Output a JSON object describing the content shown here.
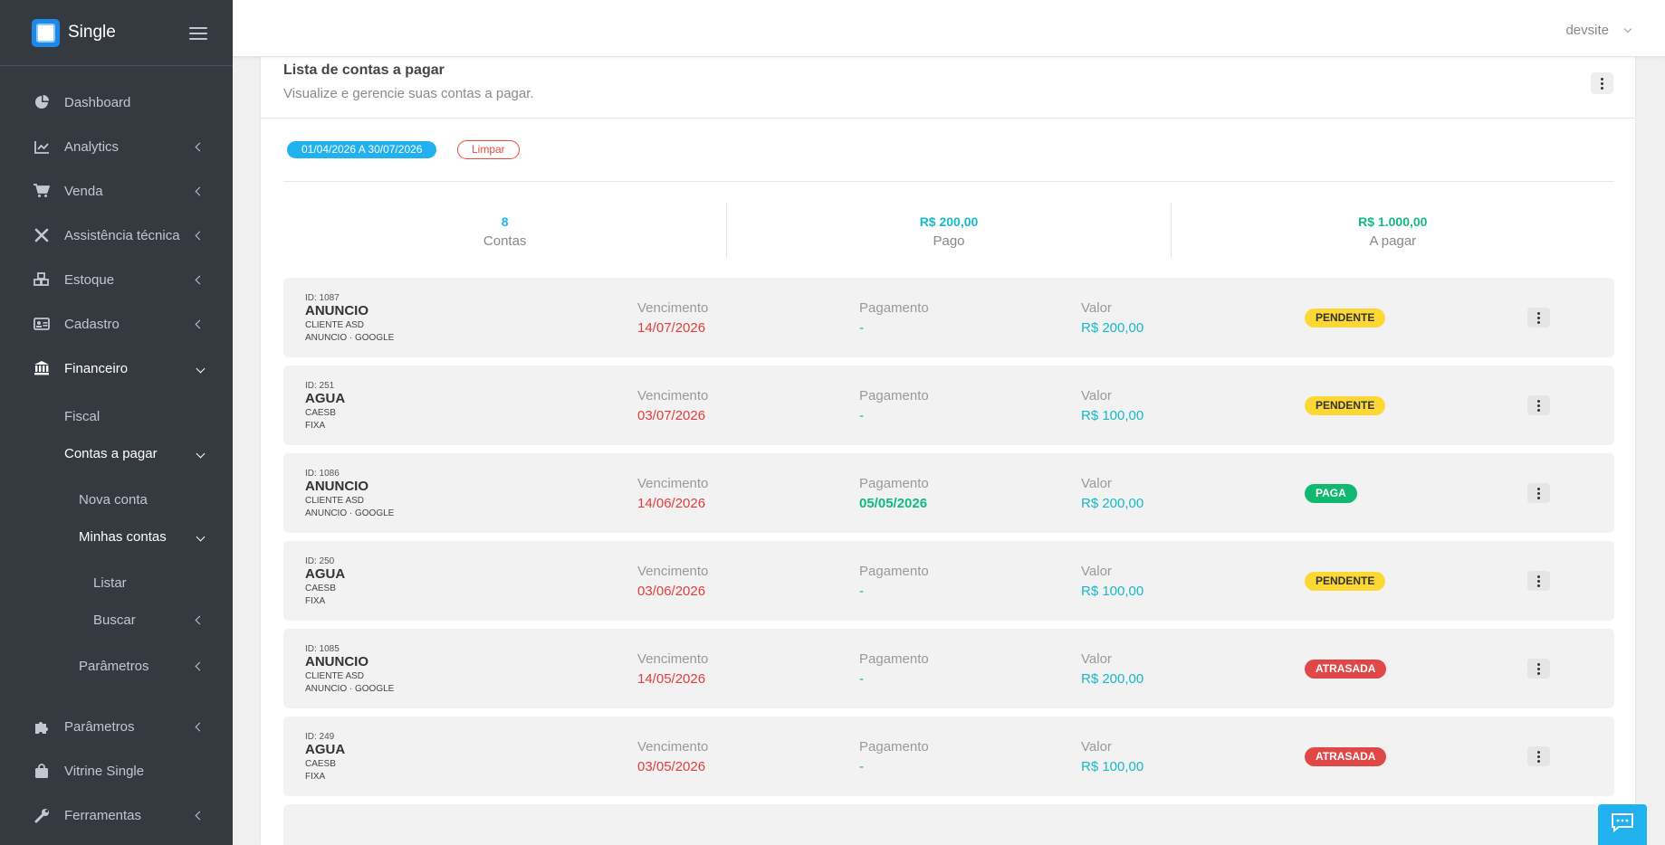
{
  "app": {
    "name": "Single"
  },
  "user": {
    "name": "devsite"
  },
  "sidebar": {
    "items": [
      {
        "label": "Dashboard"
      },
      {
        "label": "Analytics"
      },
      {
        "label": "Venda"
      },
      {
        "label": "Assistência técnica"
      },
      {
        "label": "Estoque"
      },
      {
        "label": "Cadastro"
      },
      {
        "label": "Financeiro"
      },
      {
        "label": "Fiscal"
      },
      {
        "label": "Contas a pagar"
      },
      {
        "label": "Nova conta"
      },
      {
        "label": "Minhas contas"
      },
      {
        "label": "Listar"
      },
      {
        "label": "Buscar"
      },
      {
        "label": "Parâmetros"
      },
      {
        "label": "Parâmetros"
      },
      {
        "label": "Vitrine Single"
      },
      {
        "label": "Ferramentas"
      }
    ]
  },
  "page": {
    "title": "Lista de contas a pagar",
    "subtitle": "Visualize e gerencie suas contas a pagar."
  },
  "filter": {
    "date_range": "01/04/2026 A 30/07/2026",
    "clear_label": "Limpar"
  },
  "stats": [
    {
      "value": "8",
      "label": "Contas"
    },
    {
      "value": "R$ 200,00",
      "label": "Pago"
    },
    {
      "value": "R$ 1.000,00",
      "label": "A pagar"
    }
  ],
  "columns": {
    "vencimento": "Vencimento",
    "pagamento": "Pagamento",
    "valor": "Valor"
  },
  "rows": [
    {
      "id": "ID: 1087",
      "name": "ANUNCIO",
      "line1": "CLIENTE ASD",
      "line2": "ANUNCIO · GOOGLE",
      "vencimento": "14/07/2026",
      "pagamento": "-",
      "valor": "R$ 200,00",
      "status": "PENDENTE"
    },
    {
      "id": "ID: 251",
      "name": "AGUA",
      "line1": "CAESB",
      "line2": "FIXA",
      "vencimento": "03/07/2026",
      "pagamento": "-",
      "valor": "R$ 100,00",
      "status": "PENDENTE"
    },
    {
      "id": "ID: 1086",
      "name": "ANUNCIO",
      "line1": "CLIENTE ASD",
      "line2": "ANUNCIO · GOOGLE",
      "vencimento": "14/06/2026",
      "pagamento": "05/05/2026",
      "valor": "R$ 200,00",
      "status": "PAGA"
    },
    {
      "id": "ID: 250",
      "name": "AGUA",
      "line1": "CAESB",
      "line2": "FIXA",
      "vencimento": "03/06/2026",
      "pagamento": "-",
      "valor": "R$ 100,00",
      "status": "PENDENTE"
    },
    {
      "id": "ID: 1085",
      "name": "ANUNCIO",
      "line1": "CLIENTE ASD",
      "line2": "ANUNCIO · GOOGLE",
      "vencimento": "14/05/2026",
      "pagamento": "-",
      "valor": "R$ 200,00",
      "status": "ATRASADA"
    },
    {
      "id": "ID: 249",
      "name": "AGUA",
      "line1": "CAESB",
      "line2": "FIXA",
      "vencimento": "03/05/2026",
      "pagamento": "-",
      "valor": "R$ 100,00",
      "status": "ATRASADA"
    }
  ],
  "colors": {
    "sidebar": "#343a40",
    "accent": "#21b1ef",
    "pending": "#fdd835",
    "paid": "#10b96f",
    "late": "#e04848"
  },
  "icons": [
    "chip-logo-icon",
    "hamburger-icon",
    "pie-chart-icon",
    "line-chart-icon",
    "cart-icon",
    "tools-icon",
    "cubes-icon",
    "id-card-icon",
    "bank-icon",
    "puzzle-icon",
    "shopping-bag-icon",
    "wrench-icon",
    "chat-icon",
    "kebab-menu-icon"
  ]
}
